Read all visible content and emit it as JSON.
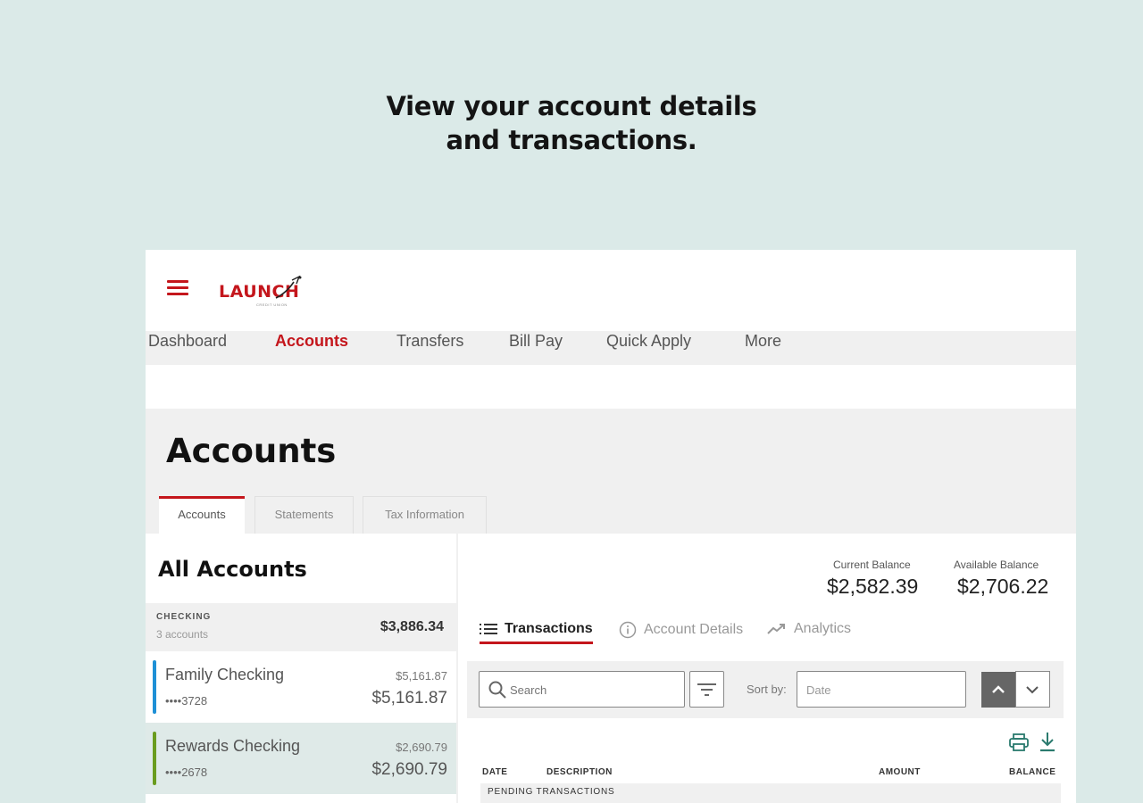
{
  "headline": {
    "line1": "View your account details",
    "line2": "and transactions."
  },
  "brand": {
    "logo_text": "LAUNCH",
    "logo_sub": "CREDIT UNION",
    "accent_color": "#c4161c"
  },
  "nav": {
    "items": [
      {
        "label": "Dashboard",
        "active": false
      },
      {
        "label": "Accounts",
        "active": true
      },
      {
        "label": "Transfers",
        "active": false
      },
      {
        "label": "Bill Pay",
        "active": false
      },
      {
        "label": "Quick Apply",
        "active": false
      },
      {
        "label": "More",
        "active": false
      }
    ]
  },
  "page": {
    "title": "Accounts",
    "tabs": [
      {
        "label": "Accounts",
        "active": true
      },
      {
        "label": "Statements",
        "active": false
      },
      {
        "label": "Tax Information",
        "active": false
      }
    ]
  },
  "accounts_panel": {
    "title": "All Accounts",
    "group": {
      "label": "CHECKING",
      "count": "3 accounts",
      "total": "$3,886.34"
    },
    "items": [
      {
        "name": "Family Checking",
        "number": "••••3728",
        "available": "$5,161.87",
        "balance": "$5,161.87",
        "color": "#1e90d6",
        "selected": false
      },
      {
        "name": "Rewards Checking",
        "number": "••••2678",
        "available": "$2,690.79",
        "balance": "$2,690.79",
        "color": "#6a9c1e",
        "selected": true
      }
    ]
  },
  "detail": {
    "current_balance_label": "Current Balance",
    "current_balance": "$2,582.39",
    "available_balance_label": "Available Balance",
    "available_balance": "$2,706.22",
    "subtabs": [
      {
        "label": "Transactions",
        "icon": "list-icon",
        "active": true
      },
      {
        "label": "Account Details",
        "icon": "info-icon",
        "active": false
      },
      {
        "label": "Analytics",
        "icon": "trend-icon",
        "active": false
      }
    ],
    "search_placeholder": "Search",
    "sort_label": "Sort by:",
    "sort_value": "Date",
    "columns": {
      "date": "DATE",
      "description": "DESCRIPTION",
      "amount": "AMOUNT",
      "balance": "BALANCE"
    },
    "pending_label": "PENDING TRANSACTIONS"
  }
}
